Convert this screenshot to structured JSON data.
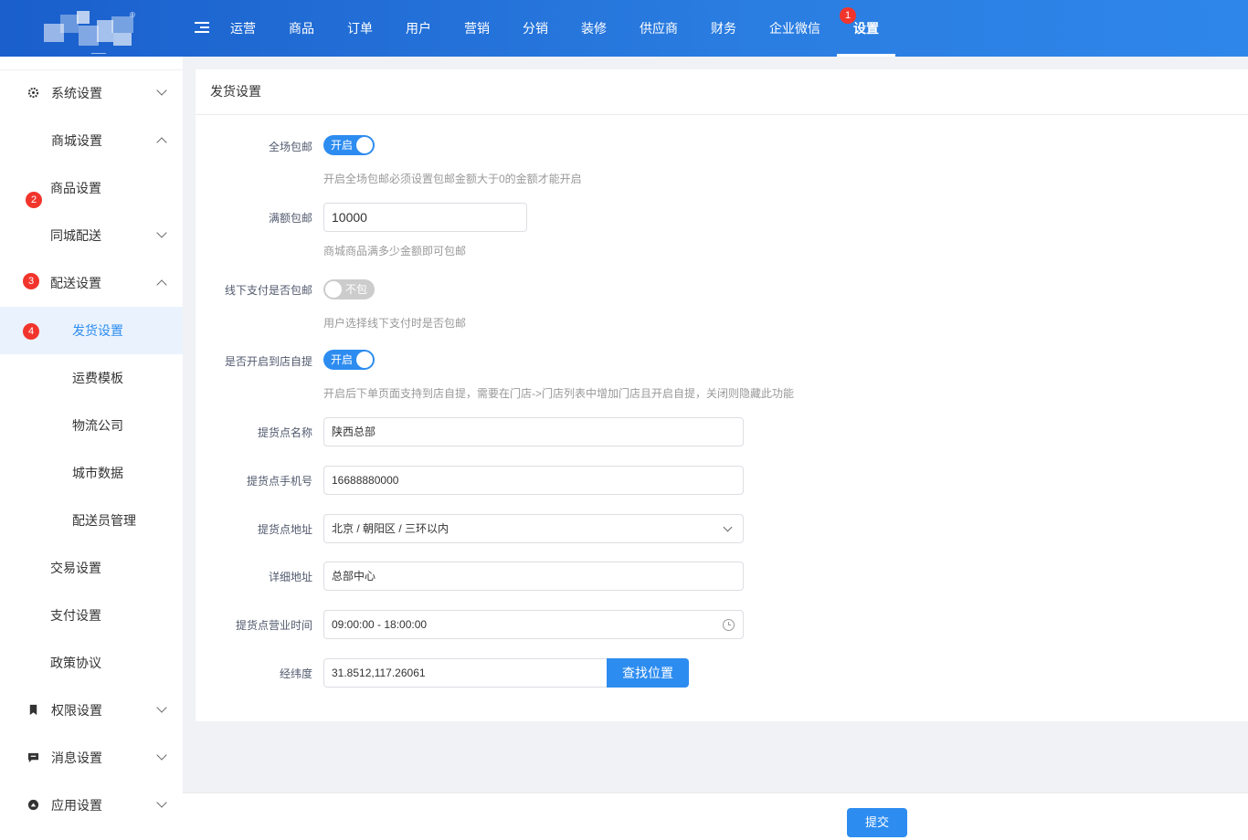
{
  "header": {
    "logo_mark": "®",
    "nav": [
      "运营",
      "商品",
      "订单",
      "用户",
      "营销",
      "分销",
      "装修",
      "供应商",
      "财务",
      "企业微信",
      "设置"
    ],
    "active_nav": "设置"
  },
  "badges": [
    "1",
    "2",
    "3",
    "4"
  ],
  "sidebar": {
    "items": [
      {
        "label": "系统设置",
        "icon": "gear-icon"
      },
      {
        "label": "商城设置"
      },
      {
        "label": "商品设置"
      },
      {
        "label": "同城配送"
      },
      {
        "label": "配送设置"
      },
      {
        "label": "发货设置"
      },
      {
        "label": "运费模板"
      },
      {
        "label": "物流公司"
      },
      {
        "label": "城市数据"
      },
      {
        "label": "配送员管理"
      },
      {
        "label": "交易设置"
      },
      {
        "label": "支付设置"
      },
      {
        "label": "政策协议"
      },
      {
        "label": "权限设置",
        "icon": "bookmark-icon"
      },
      {
        "label": "消息设置",
        "icon": "message-icon"
      },
      {
        "label": "应用设置",
        "icon": "app-icon"
      }
    ]
  },
  "form": {
    "title": "发货设置",
    "free_shipping": {
      "label": "全场包邮",
      "state": "开启",
      "help": "开启全场包邮必须设置包邮金额大于0的金额才能开启"
    },
    "threshold": {
      "label": "满额包邮",
      "value": "10000",
      "help": "商城商品满多少金额即可包邮"
    },
    "offline_pay": {
      "label": "线下支付是否包邮",
      "state": "不包",
      "help": "用户选择线下支付时是否包邮"
    },
    "self_pickup": {
      "label": "是否开启到店自提",
      "state": "开启",
      "help": "开启后下单页面支持到店自提，需要在门店->门店列表中增加门店且开启自提，关闭则隐藏此功能"
    },
    "pickup_name": {
      "label": "提货点名称",
      "value": "陕西总部"
    },
    "pickup_phone": {
      "label": "提货点手机号",
      "value": "16688880000"
    },
    "pickup_address": {
      "label": "提货点地址",
      "value": "北京 / 朝阳区 / 三环以内"
    },
    "detail_address": {
      "label": "详细地址",
      "value": "总部中心"
    },
    "business_hours": {
      "label": "提货点营业时间",
      "value": "09:00:00 - 18:00:00"
    },
    "coordinates": {
      "label": "经纬度",
      "value": "31.8512,117.26061",
      "button": "查找位置"
    }
  },
  "footer": {
    "submit": "提交"
  }
}
